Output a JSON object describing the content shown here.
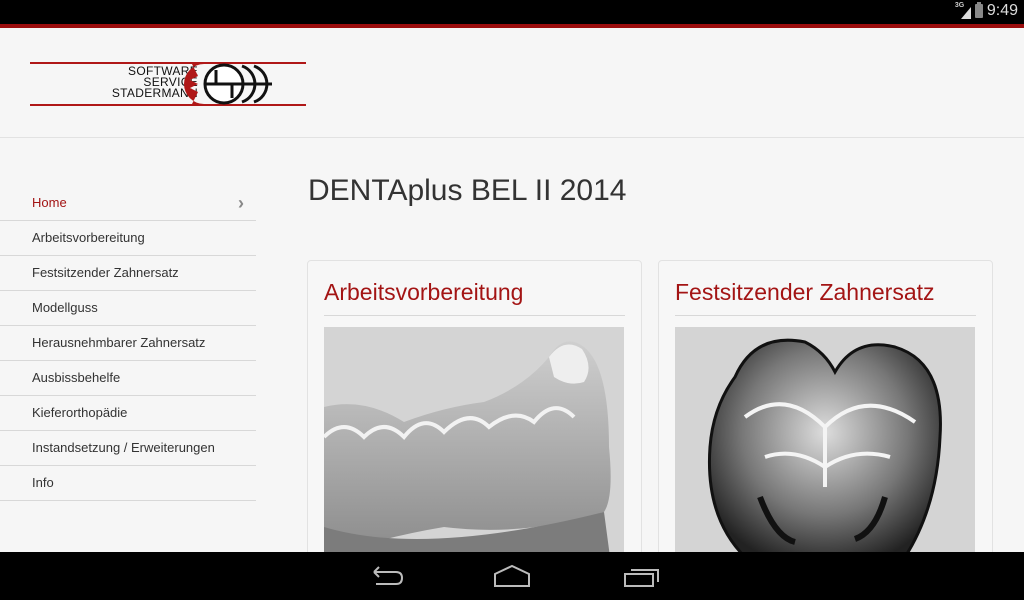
{
  "status_bar": {
    "network": "3G",
    "time": "9:49"
  },
  "header": {
    "logo_lines": [
      "SOFTWARE",
      "SERVICE",
      "STADERMANN"
    ],
    "logo_mark": "SSS"
  },
  "sidebar": {
    "items": [
      {
        "label": "Home",
        "active": true
      },
      {
        "label": "Arbeitsvorbereitung"
      },
      {
        "label": "Festsitzender Zahnersatz"
      },
      {
        "label": "Modellguss"
      },
      {
        "label": "Herausnehmbarer Zahnersatz"
      },
      {
        "label": "Ausbissbehelfe"
      },
      {
        "label": "Kieferorthopädie"
      },
      {
        "label": "Instandsetzung / Erweiterungen"
      },
      {
        "label": "Info"
      }
    ]
  },
  "main": {
    "title": "DENTAplus BEL II 2014",
    "cards": [
      {
        "title": "Arbeitsvorbereitung",
        "image": "dental-model-photo"
      },
      {
        "title": "Festsitzender Zahnersatz",
        "image": "metal-crown-photo"
      }
    ]
  },
  "nav_bar": {
    "buttons": [
      "back",
      "home",
      "recent-apps"
    ]
  },
  "colors": {
    "accent": "#a31414",
    "status_bar": "#000000",
    "background": "#f6f6f6"
  }
}
